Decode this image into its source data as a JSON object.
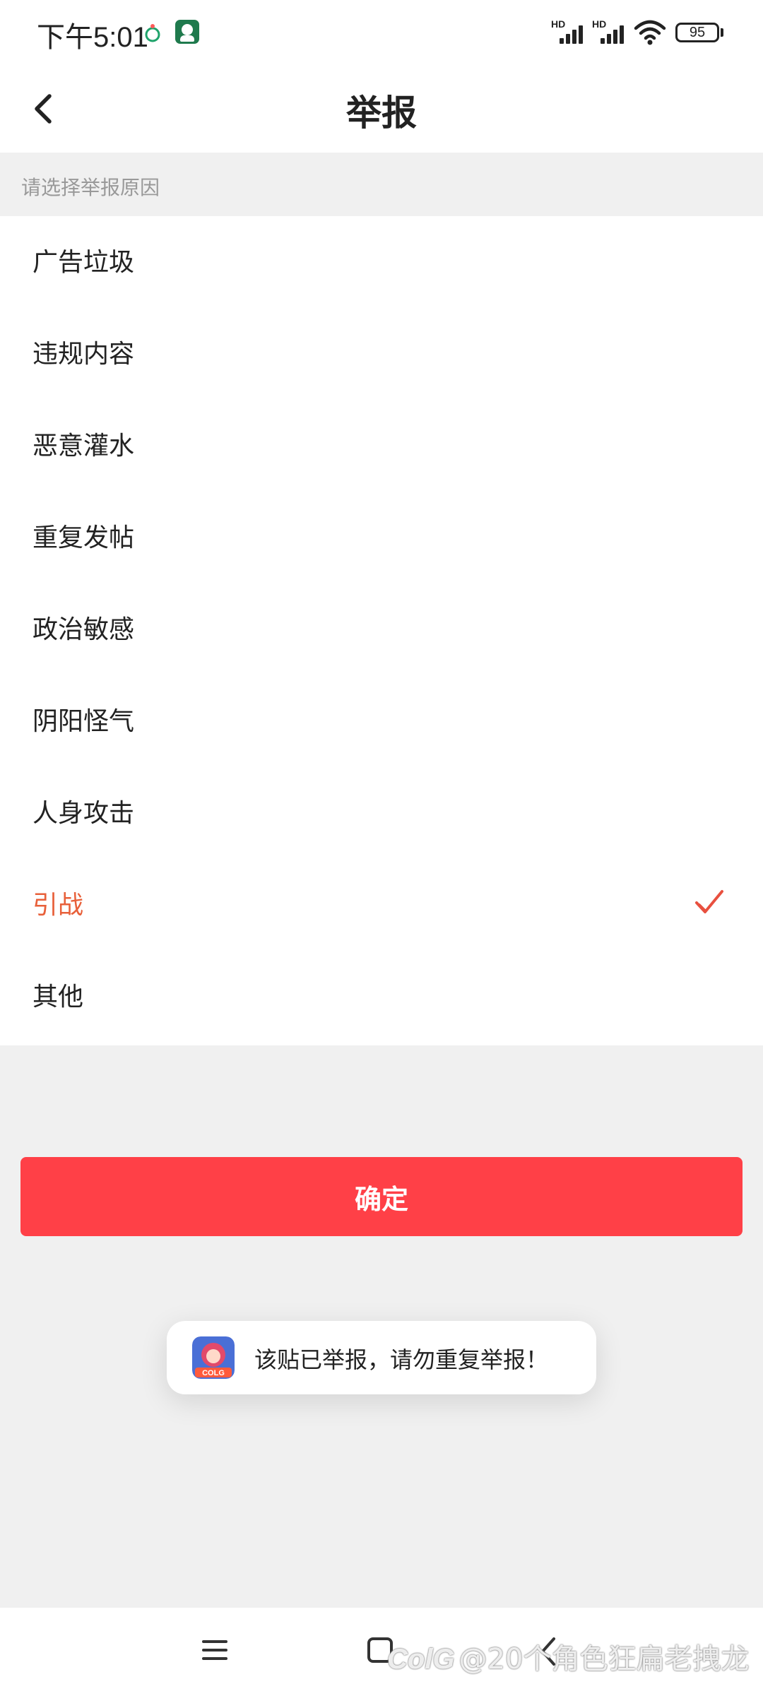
{
  "status_bar": {
    "time": "下午5:01",
    "signal_labels": [
      "HD",
      "HD"
    ],
    "battery_level": "95"
  },
  "header": {
    "title": "举报"
  },
  "section_hint": "请选择举报原因",
  "reasons": [
    {
      "label": "广告垃圾",
      "selected": false
    },
    {
      "label": "违规内容",
      "selected": false
    },
    {
      "label": "恶意灌水",
      "selected": false
    },
    {
      "label": "重复发帖",
      "selected": false
    },
    {
      "label": "政治敏感",
      "selected": false
    },
    {
      "label": "阴阳怪气",
      "selected": false
    },
    {
      "label": "人身攻击",
      "selected": false
    },
    {
      "label": "引战",
      "selected": true
    },
    {
      "label": "其他",
      "selected": false
    }
  ],
  "confirm_label": "确定",
  "toast": {
    "message": "该贴已举报，请勿重复举报！",
    "app_logo_text": "COLG"
  },
  "watermark": {
    "logo": "ColG",
    "text": "@20个角色狂扁老拽龙"
  },
  "colors": {
    "accent": "#ff4047",
    "selected_text": "#e8603a"
  }
}
